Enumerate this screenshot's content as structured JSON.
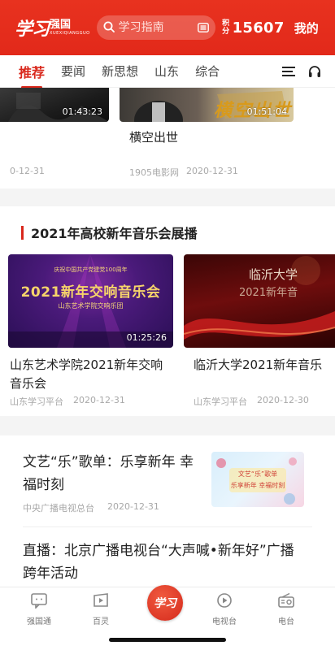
{
  "header": {
    "logo_mark": "学习",
    "logo_name": "强国",
    "logo_sub": "XUEXIQIANGGUO",
    "search_placeholder": "学习指南",
    "score_label": "积分",
    "score_value": "15607",
    "mine_label": "我的",
    "accent": "#e2291a"
  },
  "tabs": [
    "推荐",
    "要闻",
    "新思想",
    "山东",
    "综合"
  ],
  "top_cards": [
    {
      "duration": "01:43:23",
      "meta": "0-12-31"
    },
    {
      "duration": "01:51:04",
      "title": "横空出世",
      "source": "1905电影网",
      "date": "2020-12-31",
      "overlay": "横空出世"
    }
  ],
  "section": {
    "title": "2021年高校新年音乐会展播",
    "videos": [
      {
        "poster_top": "庆祝中国共产党建党100周年",
        "poster_main": "2021新年交响音乐会",
        "poster_sub": "山东艺术学院交响乐团",
        "duration": "01:25:26",
        "title": "山东艺术学院2021新年交响音乐会",
        "source": "山东学习平台",
        "date": "2020-12-31"
      },
      {
        "poster_main": "临沂大学",
        "poster_sub": "2021新年音",
        "title": "临沂大学2021新年音乐",
        "source": "山东学习平台",
        "date": "2020-12-30"
      }
    ]
  },
  "articles": [
    {
      "title": "文艺“乐”歌单：乐享新年 幸福时刻",
      "source": "中央广播电视总台",
      "date": "2020-12-31",
      "thumb_line1": "文艺“乐”歌单",
      "thumb_line2": "乐享新年 幸福时刻"
    },
    {
      "title": "直播：北京广播电视台“大声喊•新年好”广播跨年活动"
    }
  ],
  "bottom_nav": {
    "items": [
      "强国通",
      "百灵",
      "电视台",
      "电台"
    ],
    "center": "学习"
  }
}
